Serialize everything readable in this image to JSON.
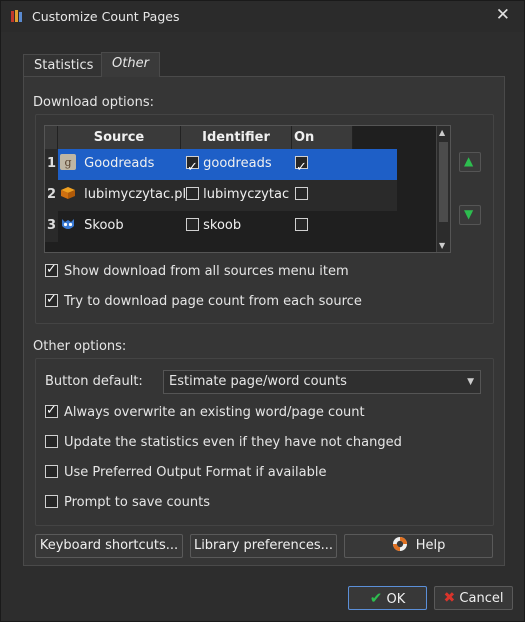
{
  "window": {
    "title": "Customize Count Pages",
    "close_glyph": "✕"
  },
  "tabs": [
    {
      "label": "Statistics"
    },
    {
      "label": "Other"
    }
  ],
  "download_options": {
    "label": "Download options:",
    "columns": [
      "Source",
      "Identifier",
      "On Menu"
    ],
    "rows": [
      {
        "num": "1",
        "source": "Goodreads",
        "identifier": "goodreads",
        "identifier_checked": true,
        "on_menu": true,
        "icon": "goodreads-icon"
      },
      {
        "num": "2",
        "source": "lubimyczytac.pl",
        "identifier": "lubimyczytac",
        "identifier_checked": false,
        "on_menu": false,
        "icon": "book-icon"
      },
      {
        "num": "3",
        "source": "Skoob",
        "identifier": "skoob",
        "identifier_checked": false,
        "on_menu": false,
        "icon": "skoob-owl-icon"
      }
    ],
    "show_all_menu": {
      "label": "Show download from all sources menu item",
      "checked": true
    },
    "try_each_source": {
      "label": "Try to download page count from each source",
      "checked": true
    }
  },
  "other_options": {
    "label": "Other options:",
    "button_default_label": "Button default:",
    "button_default_value": "Estimate page/word counts",
    "always_overwrite": {
      "label": "Always overwrite an existing word/page count",
      "checked": true
    },
    "update_stats": {
      "label": "Update the statistics even if they have not changed",
      "checked": false
    },
    "preferred_format": {
      "label": "Use Preferred Output Format if available",
      "checked": false
    },
    "prompt_save": {
      "label": "Prompt to save counts",
      "checked": false
    }
  },
  "buttons": {
    "keyboard_shortcuts": "Keyboard shortcuts...",
    "library_preferences": "Library preferences...",
    "help": "Help",
    "ok": "OK",
    "cancel": "Cancel"
  },
  "colors": {
    "selection": "#1e5fc7",
    "accent_green": "#2dbd4f",
    "cancel_red": "#d9342b"
  }
}
